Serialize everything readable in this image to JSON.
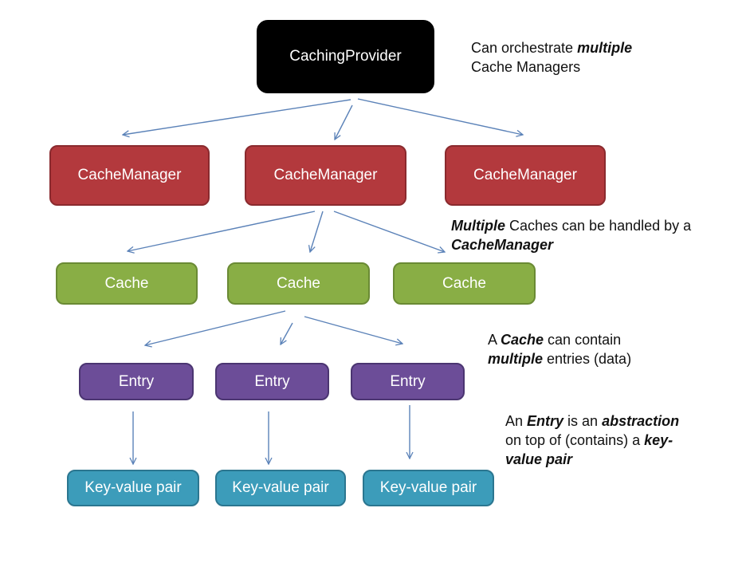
{
  "diagram": {
    "provider": {
      "label": "CachingProvider"
    },
    "managers": [
      {
        "label": "CacheManager"
      },
      {
        "label": "CacheManager"
      },
      {
        "label": "CacheManager"
      }
    ],
    "caches": [
      {
        "label": "Cache"
      },
      {
        "label": "Cache"
      },
      {
        "label": "Cache"
      }
    ],
    "entries": [
      {
        "label": "Entry"
      },
      {
        "label": "Entry"
      },
      {
        "label": "Entry"
      }
    ],
    "pairs": [
      {
        "label": "Key-value pair"
      },
      {
        "label": "Key-value pair"
      },
      {
        "label": "Key-value pair"
      }
    ],
    "edges": [
      {
        "from": "provider",
        "to": "managers.0"
      },
      {
        "from": "provider",
        "to": "managers.1"
      },
      {
        "from": "provider",
        "to": "managers.2"
      },
      {
        "from": "managers.1",
        "to": "caches.0"
      },
      {
        "from": "managers.1",
        "to": "caches.1"
      },
      {
        "from": "managers.1",
        "to": "caches.2"
      },
      {
        "from": "caches.1",
        "to": "entries.0"
      },
      {
        "from": "caches.1",
        "to": "entries.1"
      },
      {
        "from": "caches.1",
        "to": "entries.2"
      },
      {
        "from": "entries.0",
        "to": "pairs.0"
      },
      {
        "from": "entries.1",
        "to": "pairs.1"
      },
      {
        "from": "entries.2",
        "to": "pairs.2"
      }
    ],
    "colors": {
      "provider": "#000000",
      "manager": "#B3393D",
      "cache": "#89AE45",
      "entry": "#6C4D98",
      "pair": "#3C9CBA",
      "arrow": "#5B82B8"
    }
  },
  "notes": {
    "provider": {
      "line1_pre": "Can orchestrate ",
      "line1_em": "multiple",
      "line2": "Cache Managers"
    },
    "manager": {
      "line1_em": "Multiple",
      "line1_post": " Caches can be handled by a",
      "line2_em": "CacheManager"
    },
    "cache": {
      "line1_pre": "A ",
      "line1_em": "Cache",
      "line1_post": " can contain",
      "line2_em": "multiple",
      "line2_post": " entries (data)"
    },
    "entry": {
      "line1_pre": "An ",
      "line1_em1": "Entry",
      "line1_mid": " is an ",
      "line1_em2": "abstraction",
      "line2_pre": "on top of (contains) a ",
      "line2_em": "key-",
      "line3_em": "value pair"
    }
  }
}
